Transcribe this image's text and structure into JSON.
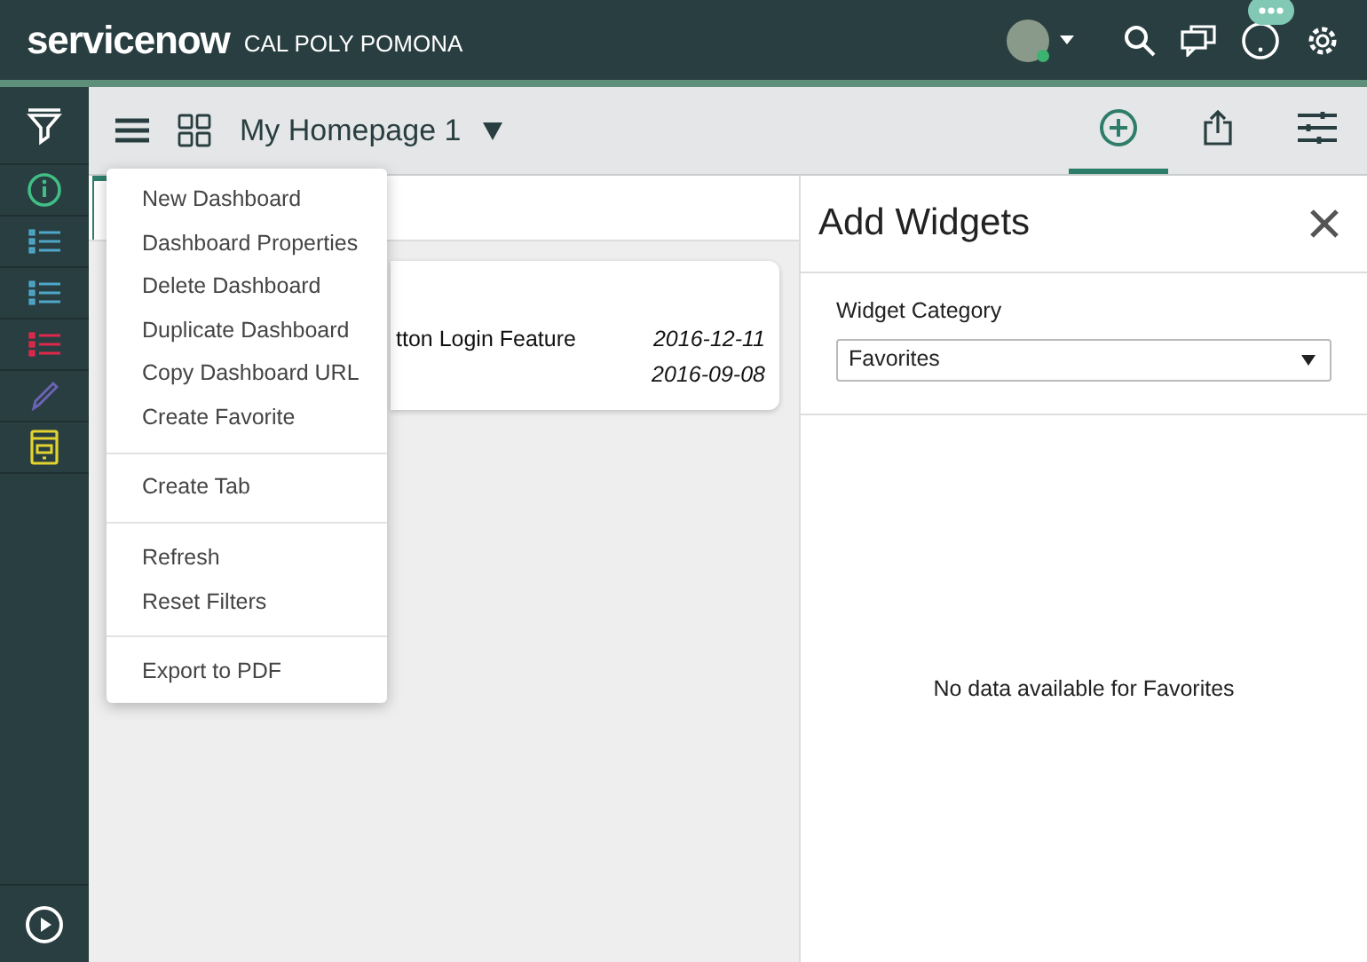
{
  "header": {
    "logo": "servicenow",
    "org": "CAL POLY POMONA"
  },
  "toolbar": {
    "title": "My Homepage 1",
    "actions": [
      {
        "kind": "add",
        "selected": true
      },
      {
        "kind": "share",
        "selected": false
      },
      {
        "kind": "settings",
        "selected": false
      }
    ]
  },
  "menu": [
    [
      "New Dashboard",
      "Dashboard Properties",
      "Delete Dashboard",
      "Duplicate Dashboard",
      "Copy Dashboard URL",
      "Create Favorite"
    ],
    [
      "Create Tab"
    ],
    [
      "Refresh",
      "Reset Filters"
    ],
    [
      "Export to PDF"
    ]
  ],
  "card": {
    "rows": [
      {
        "title": "tton Login Feature",
        "date": "2016-12-11"
      },
      {
        "date": "2016-09-08"
      }
    ]
  },
  "panel": {
    "title": "Add Widgets",
    "category_label": "Widget Category",
    "category_value": "Favorites",
    "empty_message": "No data available for Favorites"
  }
}
